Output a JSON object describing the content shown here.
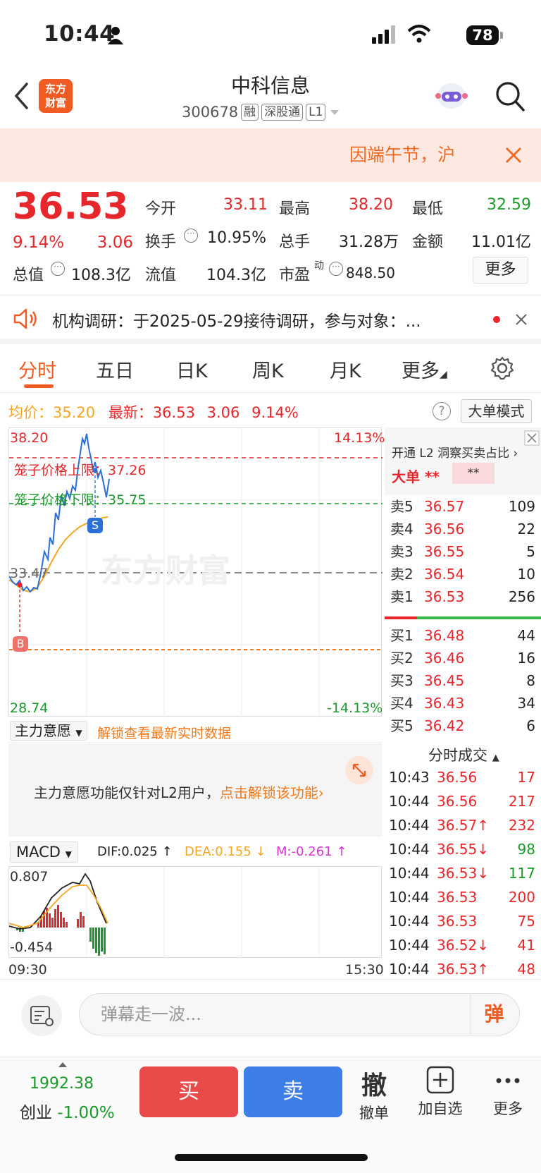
{
  "status": {
    "time": "10:44",
    "battery": "78"
  },
  "header": {
    "logo_text": "东方财富",
    "stock_name": "中科信息",
    "code": "300678",
    "tags": [
      "融",
      "深股通",
      "L1"
    ]
  },
  "notice": {
    "text": "因端午节，沪"
  },
  "quote": {
    "price": "36.53",
    "change_pct": "9.14%",
    "change": "3.06",
    "open_label": "今开",
    "open": "33.11",
    "high_label": "最高",
    "high": "38.20",
    "low_label": "最低",
    "low": "32.59",
    "turnover_label": "换手",
    "turnover": "10.95%",
    "volume_label": "总手",
    "volume": "31.28万",
    "amount_label": "金额",
    "amount": "11.01亿",
    "mcap_label": "总值",
    "mcap": "108.3亿",
    "float_label": "流值",
    "float": "104.3亿",
    "pe_label": "市盈",
    "pe_sup": "动",
    "pe": "848.50",
    "more": "更多"
  },
  "announcement": {
    "text": "机构调研：于2025-05-29接待调研，参与对象：..."
  },
  "tabs": [
    "分时",
    "五日",
    "日K",
    "周K",
    "月K",
    "更多"
  ],
  "info": {
    "avg_label": "均价：",
    "avg": "35.20",
    "last_label": "最新：",
    "last": "36.53",
    "chg": "3.06",
    "pct": "9.14%",
    "bigorder": "大单模式"
  },
  "chart": {
    "y_top": "38.20",
    "y_top_pct": "14.13%",
    "upper_limit_label": "笼子价格上限：",
    "upper_limit": "37.26",
    "lower_limit_label": "笼子价格下限：",
    "lower_limit": "35.75",
    "prev_close": "33.47",
    "y_bottom": "28.74",
    "y_bottom_pct": "-14.13%",
    "watermark": "东方财富",
    "marker_s": "S",
    "marker_b": "B",
    "time_start": "09:30",
    "time_end": "15:30"
  },
  "main_force": {
    "dropdown": "主力意愿",
    "unlock_link": "解锁查看最新实时数据",
    "l2_text": "主力意愿功能仅针对L2用户，",
    "l2_link": "点击解锁该功能"
  },
  "macd": {
    "dropdown": "MACD",
    "dif": "DIF:0.025 ↑",
    "dea": "DEA:0.155 ↓",
    "m": "M:-0.261 ↑",
    "y_top": "0.807",
    "y_bottom": "-0.454"
  },
  "right_panel": {
    "l2_promo": "开通 L2 洞察买卖占比",
    "big_label": "大单",
    "big_val1": "**",
    "big_val2": "**",
    "asks": [
      {
        "label": "卖5",
        "price": "36.57",
        "vol": "109"
      },
      {
        "label": "卖4",
        "price": "36.56",
        "vol": "22"
      },
      {
        "label": "卖3",
        "price": "36.55",
        "vol": "5"
      },
      {
        "label": "卖2",
        "price": "36.54",
        "vol": "10"
      },
      {
        "label": "卖1",
        "price": "36.53",
        "vol": "256"
      }
    ],
    "bids": [
      {
        "label": "买1",
        "price": "36.48",
        "vol": "44"
      },
      {
        "label": "买2",
        "price": "36.46",
        "vol": "16"
      },
      {
        "label": "买3",
        "price": "36.45",
        "vol": "8"
      },
      {
        "label": "买4",
        "price": "36.43",
        "vol": "34"
      },
      {
        "label": "买5",
        "price": "36.42",
        "vol": "6"
      }
    ],
    "trades_title": "分时成交",
    "trades": [
      {
        "time": "10:43",
        "price": "36.56",
        "vol": "17",
        "arrow": "",
        "color": "red"
      },
      {
        "time": "10:44",
        "price": "36.56",
        "vol": "217",
        "arrow": "",
        "color": "red"
      },
      {
        "time": "10:44",
        "price": "36.57↑",
        "vol": "232",
        "arrow": "up",
        "color": "red"
      },
      {
        "time": "10:44",
        "price": "36.55↓",
        "vol": "98",
        "arrow": "down",
        "color": "green"
      },
      {
        "time": "10:44",
        "price": "36.53↓",
        "vol": "117",
        "arrow": "down",
        "color": "green"
      },
      {
        "time": "10:44",
        "price": "36.53",
        "vol": "200",
        "arrow": "",
        "color": "red"
      },
      {
        "time": "10:44",
        "price": "36.53",
        "vol": "75",
        "arrow": "",
        "color": "red"
      },
      {
        "time": "10:44",
        "price": "36.52↓",
        "vol": "41",
        "arrow": "down",
        "color": "red"
      },
      {
        "time": "10:44",
        "price": "36.53↑",
        "vol": "48",
        "arrow": "up",
        "color": "red"
      }
    ]
  },
  "comment": {
    "placeholder": "弹幕走一波...",
    "danmu": "弹"
  },
  "bottom": {
    "index_value": "1992.38",
    "index_name": "创业",
    "index_pct": "-1.00%",
    "buy": "买",
    "sell": "卖",
    "cancel_icon": "撤",
    "cancel": "撤单",
    "add": "加自选",
    "more": "更多"
  },
  "colors": {
    "up": "#e6262b",
    "down": "#1a9a2a",
    "brand": "#f05a23",
    "avg_line": "#f5a623",
    "price_line": "#2c6fd6"
  }
}
